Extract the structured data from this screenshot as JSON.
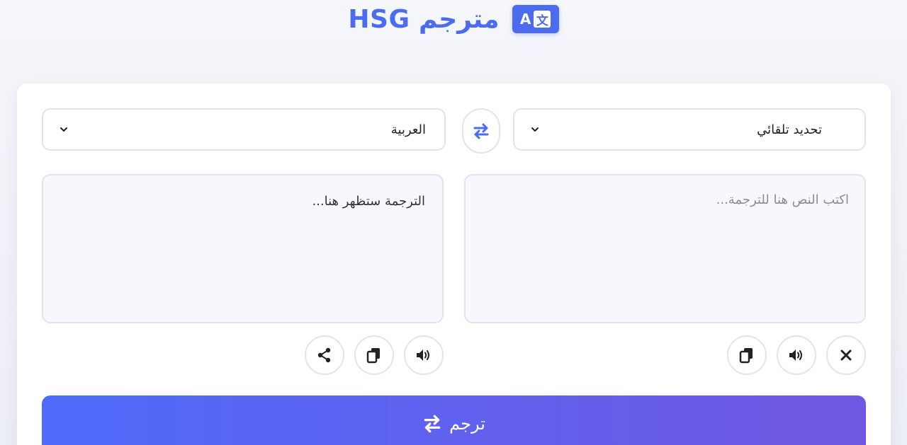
{
  "header": {
    "title": "مترجم HSG",
    "logo_icon": "translate-icon"
  },
  "languages": {
    "source_selected": "تحديد تلقائي",
    "target_selected": "العربية"
  },
  "input": {
    "placeholder": "اكتب النص هنا للترجمة...",
    "value": ""
  },
  "output": {
    "placeholder": "الترجمة ستظهر هنا..."
  },
  "actions": {
    "translate_label": "ترجم"
  },
  "colors": {
    "accent": "#4b6cf0",
    "button_gradient_start": "#4f6bfb",
    "button_gradient_end": "#7158e2"
  }
}
